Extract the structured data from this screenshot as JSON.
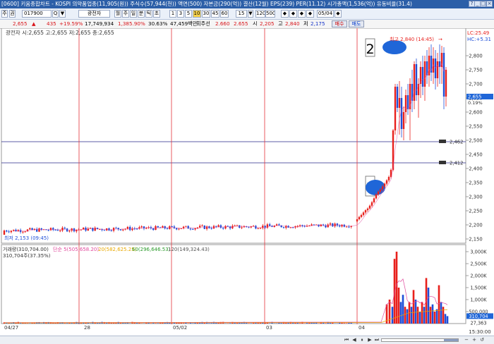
{
  "window": {
    "title": "[0600] 키움종합차트 - KOSPI 의약품업종(11,905(원)) 주식수(57,944(천)) 액면(500) 자본금(290(억)) 결산(12월) EPS(239) PER(11.12) 시가총액(1,536(억)) 유동비율(31.4)",
    "help": "?",
    "minimize": "_",
    "maximize": "□",
    "close": "×"
  },
  "toolbar": {
    "items": [
      "주",
      "권",
      "017900",
      "Q",
      "▼",
      "광전자",
      "월",
      "주",
      "일",
      "분",
      "틱",
      "초",
      "1",
      "3",
      "5",
      "10",
      "30",
      "45",
      "60",
      "15",
      "▼",
      "120",
      "500",
      "◆",
      "◆",
      "◆",
      "◆",
      "05/04",
      "◆"
    ],
    "selected": "10"
  },
  "infobar": {
    "price": "2,655",
    "change": "435",
    "rate": "+19.59%",
    "volume": "17,749,934",
    "volume_rate": "1,385.90%",
    "turnover": "30.63%",
    "amount": "47,459백만",
    "amount_label": "회주선",
    "v1": "2.660",
    "v2": "2.655",
    "open_label": "시",
    "open": "2,205",
    "high_label": "고",
    "high": "2,840",
    "low_label": "저",
    "low": "2,175",
    "buy_label": "매수",
    "sell_label": "매도"
  },
  "legend": {
    "price_header": "광전자 시:2,655 고:2,655 저:2,655 종:2,655",
    "low_marker": "최저 2,153 (09:45)",
    "high_marker": "최고 2,840 (14:45)",
    "lc_label": "LC:25.49",
    "hc_label": "HC:+5.31",
    "volume_header_name": "거래량(310,704.00)",
    "volume_header_ma1": "단순 5(505,658.20)",
    "volume_header_ma2": "20(582,625.25)",
    "volume_header_ma3": "60(296,646.53)",
    "volume_header_ma4": "120(149,324.43)",
    "volume_value_line": "310,704주(37.35%)"
  },
  "annotations": {
    "marker1": "1",
    "marker2": "2"
  },
  "hlines": {
    "line1": "2,462",
    "line2": "2,412"
  },
  "price_axis": [
    "2,800",
    "2,750",
    "2,700",
    "2,650",
    "2,600",
    "2,550",
    "2,500",
    "2,450",
    "2,400",
    "2,350",
    "2,300",
    "2,250",
    "2,200",
    "2,150"
  ],
  "price_current": "2,655",
  "price_current_sub": "0.19%",
  "volume_axis": [
    "3,000K",
    "2,500K",
    "2,000K",
    "1,500K",
    "1,000K",
    "500,000",
    "310,704",
    "27,363"
  ],
  "x_axis": [
    "04/27",
    "28",
    "05/02",
    "03",
    "04"
  ],
  "time_label": "15:30:00",
  "colors": {
    "up": "#e8201c",
    "down": "#1f4fd8",
    "accent": "#2c5fa8",
    "ma_pink": "#e0489c",
    "current_box": "#1f66d8"
  }
}
